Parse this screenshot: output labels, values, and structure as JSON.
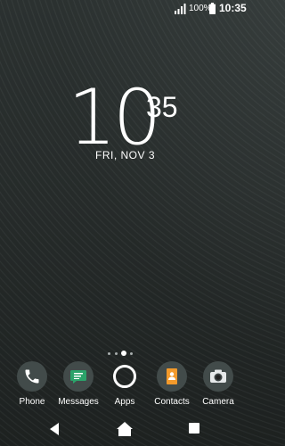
{
  "status": {
    "battery_percent": "100%",
    "time": "10:35"
  },
  "clock": {
    "hour": "10",
    "minute": "35",
    "date": "FRI, NOV 3"
  },
  "pages": {
    "count": 3,
    "active": 2
  },
  "dock": [
    {
      "label": "Phone",
      "icon": "phone-icon"
    },
    {
      "label": "Messages",
      "icon": "messages-icon"
    },
    {
      "label": "Apps",
      "icon": "apps-icon"
    },
    {
      "label": "Contacts",
      "icon": "contacts-icon"
    },
    {
      "label": "Camera",
      "icon": "camera-icon"
    }
  ],
  "colors": {
    "messages": "#2ba36a",
    "contacts": "#f39a2b",
    "dock_icon_bg": "#424b4a"
  }
}
